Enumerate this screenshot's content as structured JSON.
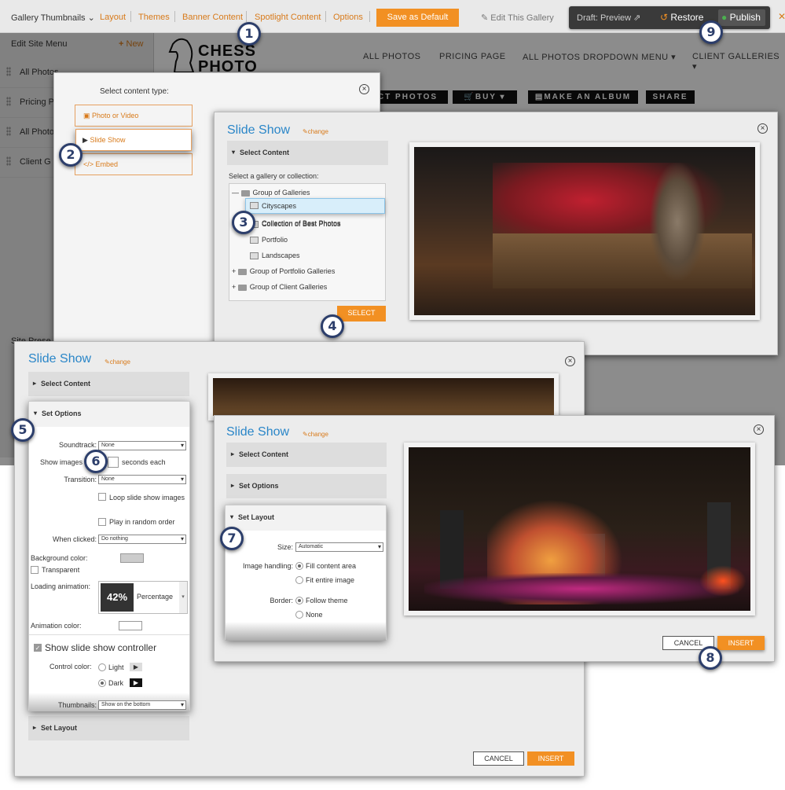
{
  "topbar": {
    "gallery_select": "Gallery Thumbnails",
    "layout": "Layout",
    "themes": "Themes",
    "banner": "Banner Content",
    "spotlight": "Spotlight Content",
    "options": "Options",
    "save_default": "Save as Default",
    "edit_gallery": "Edit This Gallery",
    "draft_preview": "Draft: Preview",
    "restore": "Restore",
    "publish": "Publish"
  },
  "sidebar": {
    "title": "Edit Site Menu",
    "new_label": "New",
    "items": [
      {
        "label": "All Photos"
      },
      {
        "label": "Pricing P"
      },
      {
        "label": "All Photo"
      },
      {
        "label": "Client G"
      }
    ],
    "footer": "Site Prese"
  },
  "site": {
    "logo_top": "CHESS",
    "logo_bottom": "PHOTO",
    "nav": [
      "ALL PHOTOS",
      "PRICING PAGE",
      "ALL PHOTOS DROPDOWN MENU",
      "CLIENT GALLERIES"
    ],
    "buttons": [
      "CT PHOTOS",
      "BUY",
      "MAKE AN ALBUM",
      "SHARE"
    ]
  },
  "content_type": {
    "title": "Select content type:",
    "options": [
      "Photo or Video",
      "Slide Show",
      "Embed"
    ]
  },
  "panel1": {
    "title": "Slide Show",
    "change": "change",
    "section": "Select Content",
    "prompt": "Select a gallery or collection:",
    "tree": [
      "Group of Galleries",
      "Cityscapes",
      "Collection of Best Photos",
      "Portfolio",
      "Landscapes",
      "Group of Portfolio Galleries",
      "Group of Client Galleries"
    ],
    "select_btn": "SELECT"
  },
  "panel2": {
    "title": "Slide Show",
    "change": "change",
    "sections": [
      "Select Content",
      "Set Options",
      "Set Layout"
    ],
    "soundtrack_label": "Soundtrack:",
    "soundtrack_value": "None",
    "show_images_label": "Show images",
    "seconds_label": "seconds each",
    "transition_label": "Transition:",
    "transition_value": "None",
    "loop_label": "Loop slide show images",
    "random_label": "Play in random order",
    "when_clicked_label": "When clicked:",
    "when_clicked_value": "Do nothing",
    "bg_color_label": "Background color:",
    "transparent_label": "Transparent",
    "loading_anim_label": "Loading animation:",
    "loading_value": "42%",
    "loading_type": "Percentage",
    "anim_color_label": "Animation color:",
    "show_controller_label": "Show slide show controller",
    "control_color_label": "Control color:",
    "light_label": "Light",
    "dark_label": "Dark",
    "thumbnails_label": "Thumbnails:",
    "thumbnails_value": "Show on the bottom",
    "cancel": "CANCEL",
    "insert": "INSERT"
  },
  "panel3": {
    "title": "Slide Show",
    "change": "change",
    "sections": [
      "Select Content",
      "Set Options",
      "Set Layout"
    ],
    "size_label": "Size:",
    "size_value": "Automatic",
    "image_handling_label": "Image handling:",
    "fill_label": "Fill content area",
    "fit_label": "Fit entire image",
    "border_label": "Border:",
    "follow_label": "Follow theme",
    "none_label": "None",
    "cancel": "CANCEL",
    "insert": "INSERT"
  },
  "markers": [
    "1",
    "2",
    "3",
    "4",
    "5",
    "6",
    "7",
    "8",
    "9"
  ],
  "colors": {
    "accent": "#f29023",
    "title_blue": "#2a86c8",
    "marker": "#2c3e6b"
  }
}
